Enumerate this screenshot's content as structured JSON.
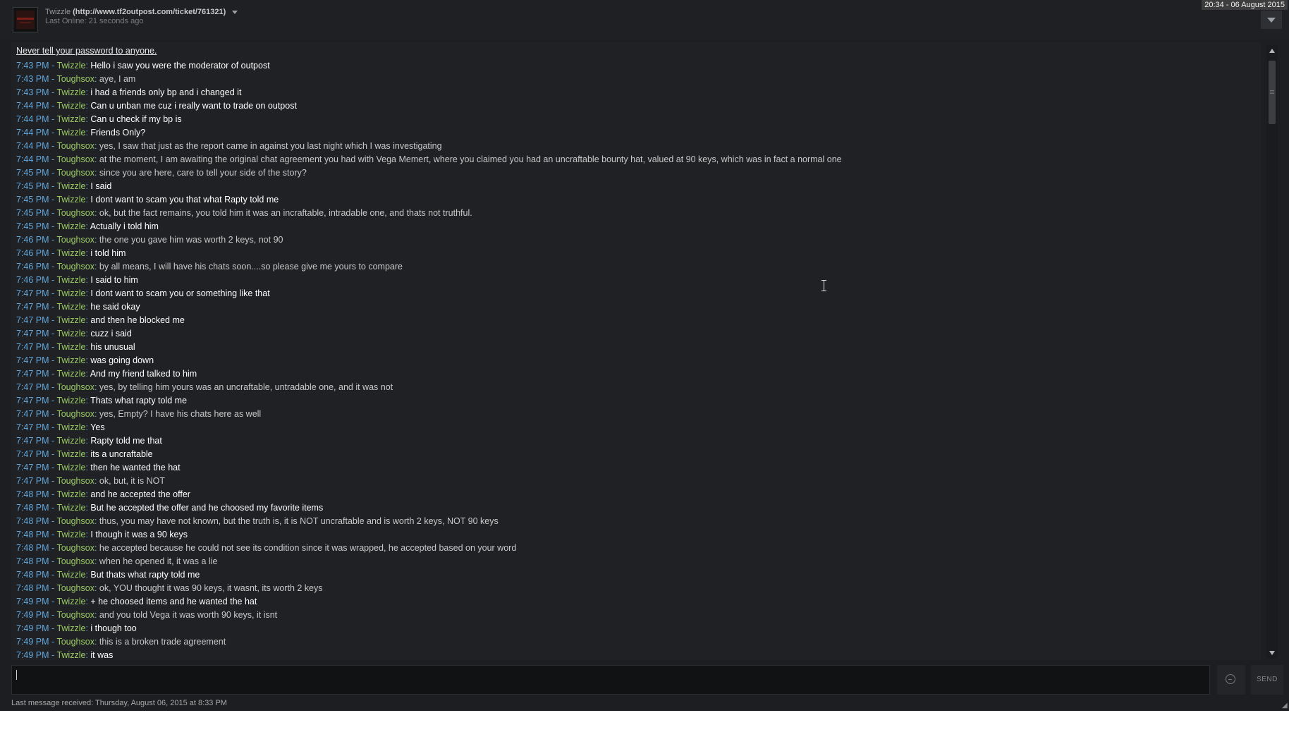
{
  "header": {
    "name": "Twizzle",
    "url_text": "(http://www.tf2outpost.com/ticket/761321)",
    "status": "Last Online: 21 seconds ago",
    "clock": "20:34 - 06 August 2015"
  },
  "chat": {
    "warning": "Never tell your password to anyone.",
    "messages": [
      {
        "time": "7:43 PM",
        "speaker": "Twizzle",
        "text": "Hello i saw you were the moderator of outpost"
      },
      {
        "time": "7:43 PM",
        "speaker": "Toughsox",
        "text": "aye, I am"
      },
      {
        "time": "7:43 PM",
        "speaker": "Twizzle",
        "text": "i had a friends only bp and i changed it"
      },
      {
        "time": "7:44 PM",
        "speaker": "Twizzle",
        "text": "Can u unban me cuz i really want to trade on outpost"
      },
      {
        "time": "7:44 PM",
        "speaker": "Twizzle",
        "text": "Can u check if my bp is"
      },
      {
        "time": "7:44 PM",
        "speaker": "Twizzle",
        "text": "Friends Only?"
      },
      {
        "time": "7:44 PM",
        "speaker": "Toughsox",
        "text": "yes, I saw that just as the report came in against you last night which I was investigating"
      },
      {
        "time": "7:44 PM",
        "speaker": "Toughsox",
        "text": "at the moment, I am awaiting the original chat agreement you had with Vega Memert, where you claimed you had an uncraftable bounty hat, valued at 90 keys, which was in fact a normal one"
      },
      {
        "time": "7:45 PM",
        "speaker": "Toughsox",
        "text": "since you are here, care to tell your side of the story?"
      },
      {
        "time": "7:45 PM",
        "speaker": "Twizzle",
        "text": "I said"
      },
      {
        "time": "7:45 PM",
        "speaker": "Twizzle",
        "text": "I dont want to scam you that what Rapty told me"
      },
      {
        "time": "7:45 PM",
        "speaker": "Toughsox",
        "text": "ok, but the fact remains, you told him it was an incraftable, intradable one, and thats not truthful."
      },
      {
        "time": "7:45 PM",
        "speaker": "Twizzle",
        "text": "Actually i told him"
      },
      {
        "time": "7:46 PM",
        "speaker": "Toughsox",
        "text": "the one you gave him was worth 2 keys, not 90"
      },
      {
        "time": "7:46 PM",
        "speaker": "Twizzle",
        "text": "i told him"
      },
      {
        "time": "7:46 PM",
        "speaker": "Toughsox",
        "text": "by all means, I will have his chats soon....so please give me yours to compare"
      },
      {
        "time": "7:46 PM",
        "speaker": "Twizzle",
        "text": "I said to him"
      },
      {
        "time": "7:47 PM",
        "speaker": "Twizzle",
        "text": "I dont want to scam you or something like that"
      },
      {
        "time": "7:47 PM",
        "speaker": "Twizzle",
        "text": "he said okay"
      },
      {
        "time": "7:47 PM",
        "speaker": "Twizzle",
        "text": "and then he blocked me"
      },
      {
        "time": "7:47 PM",
        "speaker": "Twizzle",
        "text": "cuzz i said"
      },
      {
        "time": "7:47 PM",
        "speaker": "Twizzle",
        "text": "his unusual"
      },
      {
        "time": "7:47 PM",
        "speaker": "Twizzle",
        "text": "was going down"
      },
      {
        "time": "7:47 PM",
        "speaker": "Twizzle",
        "text": "And my friend talked to him"
      },
      {
        "time": "7:47 PM",
        "speaker": "Toughsox",
        "text": "yes, by telling him yours was an uncraftable, untradable one, and it was not"
      },
      {
        "time": "7:47 PM",
        "speaker": "Twizzle",
        "text": "Thats what rapty told me"
      },
      {
        "time": "7:47 PM",
        "speaker": "Toughsox",
        "text": "yes, Empty?  I have his chats here as well"
      },
      {
        "time": "7:47 PM",
        "speaker": "Twizzle",
        "text": "Yes"
      },
      {
        "time": "7:47 PM",
        "speaker": "Twizzle",
        "text": "Rapty told me that"
      },
      {
        "time": "7:47 PM",
        "speaker": "Twizzle",
        "text": "its a uncraftable"
      },
      {
        "time": "7:47 PM",
        "speaker": "Twizzle",
        "text": "then he wanted the hat"
      },
      {
        "time": "7:47 PM",
        "speaker": "Toughsox",
        "text": "ok, but, it is NOT"
      },
      {
        "time": "7:48 PM",
        "speaker": "Twizzle",
        "text": "and he accepted the offer"
      },
      {
        "time": "7:48 PM",
        "speaker": "Twizzle",
        "text": "But he accepted the offer and he choosed my favorite items"
      },
      {
        "time": "7:48 PM",
        "speaker": "Toughsox",
        "text": "thus, you may have not known, but the truth is, it is NOT uncraftable and is worth 2 keys, NOT 90 keys"
      },
      {
        "time": "7:48 PM",
        "speaker": "Twizzle",
        "text": "I though it was a 90 keys"
      },
      {
        "time": "7:48 PM",
        "speaker": "Toughsox",
        "text": "he accepted because he could not see its condition since it was wrapped, he accepted based on your word"
      },
      {
        "time": "7:48 PM",
        "speaker": "Toughsox",
        "text": "when he opened it, it was a lie"
      },
      {
        "time": "7:48 PM",
        "speaker": "Twizzle",
        "text": "But thats what rapty told me"
      },
      {
        "time": "7:48 PM",
        "speaker": "Toughsox",
        "text": "ok, YOU thought it was 90 keys, it wasnt, its worth 2 keys"
      },
      {
        "time": "7:49 PM",
        "speaker": "Twizzle",
        "text": "+ he choosed items and he wanted the hat"
      },
      {
        "time": "7:49 PM",
        "speaker": "Toughsox",
        "text": "and you told Vega it was worth 90 keys, it isnt"
      },
      {
        "time": "7:49 PM",
        "speaker": "Twizzle",
        "text": "i though too"
      },
      {
        "time": "7:49 PM",
        "speaker": "Toughsox",
        "text": "this is a broken trade agreement"
      },
      {
        "time": "7:49 PM",
        "speaker": "Twizzle",
        "text": "it was"
      }
    ]
  },
  "input": {
    "value": "",
    "send_label": "SEND"
  },
  "footer": {
    "last_message": "Last message received: Thursday, August 06, 2015 at 8:33 PM"
  },
  "colors": {
    "background": "#1d1e21",
    "timestamp": "#62a8dd",
    "speaker": "#9ccc65",
    "self_message": "#c9c9c9",
    "other_message": "#ffffff"
  },
  "icons": {
    "header_dropdown": "chevron-down-icon",
    "menu": "triangle-down-icon",
    "emoticon": "emoticon-icon",
    "scroll_up": "arrow-up-icon",
    "scroll_down": "arrow-down-icon",
    "resize": "resize-grip-icon"
  }
}
